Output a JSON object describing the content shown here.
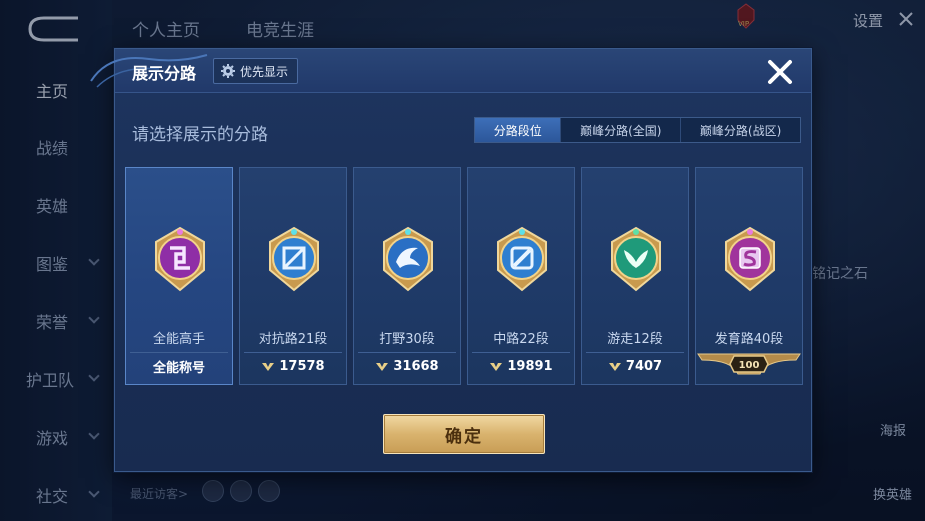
{
  "background": {
    "top_tabs": [
      "个人主页",
      "电竞生涯"
    ],
    "settings_label": "设置",
    "vip_label": "VIP",
    "left_nav": [
      {
        "label": "主页",
        "active": true,
        "has_chevron": false
      },
      {
        "label": "战绩",
        "active": false,
        "has_chevron": false
      },
      {
        "label": "英雄",
        "active": false,
        "has_chevron": false
      },
      {
        "label": "图鉴",
        "active": false,
        "has_chevron": true
      },
      {
        "label": "荣誉",
        "active": false,
        "has_chevron": true
      },
      {
        "label": "护卫队",
        "active": false,
        "has_chevron": true
      },
      {
        "label": "游戏",
        "active": false,
        "has_chevron": true
      },
      {
        "label": "社交",
        "active": false,
        "has_chevron": true
      }
    ],
    "recent_visitors_label": "最近访客>",
    "side_text": "铭记之石",
    "poster_label": "海报",
    "change_hero_label": "换英雄"
  },
  "modal": {
    "title": "展示分路",
    "priority_button_label": "优先显示",
    "subtitle": "请选择展示的分路",
    "tabs": [
      {
        "label": "分路段位",
        "active": true
      },
      {
        "label": "巅峰分路(全国)",
        "active": false
      },
      {
        "label": "巅峰分路(战区)",
        "active": false
      }
    ],
    "cards": [
      {
        "name": "全能高手",
        "bottom": "全能称号",
        "badge": "all-round",
        "selected": true
      },
      {
        "name": "对抗路21段",
        "bottom": "17578",
        "badge": "clash-lane",
        "selected": false
      },
      {
        "name": "打野30段",
        "bottom": "31668",
        "badge": "jungle",
        "selected": false
      },
      {
        "name": "中路22段",
        "bottom": "19891",
        "badge": "mid-lane",
        "selected": false
      },
      {
        "name": "游走12段",
        "bottom": "7407",
        "badge": "roam",
        "selected": false
      },
      {
        "name": "发育路40段",
        "bottom": "100",
        "badge": "farm-lane",
        "selected": false
      }
    ],
    "confirm_label": "确定"
  },
  "colors": {
    "accent_blue": "#3d6fb8",
    "gold": "#d9b36e",
    "purple_badge": "#b54bc8",
    "blue_badge": "#2f8fd8",
    "green_badge": "#2fae88"
  }
}
